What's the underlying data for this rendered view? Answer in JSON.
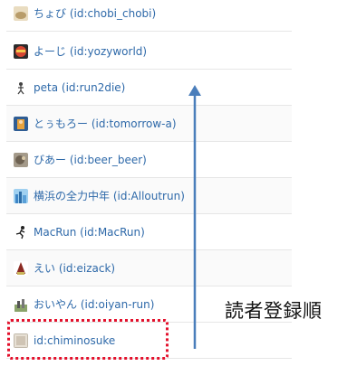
{
  "readers": [
    {
      "name": "ちょび",
      "id_label": "(id:chobi_chobi)",
      "icon": "chobi-avatar-icon",
      "color": "#d8c29a"
    },
    {
      "name": "よーじ",
      "id_label": "(id:yozyworld)",
      "icon": "yozy-avatar-icon",
      "color": "#c0392b"
    },
    {
      "name": "peta",
      "id_label": "(id:run2die)",
      "icon": "peta-avatar-icon",
      "color": "#e0e0e0"
    },
    {
      "name": "とぅもろー",
      "id_label": "(id:tomorrow-a)",
      "icon": "tomorrow-avatar-icon",
      "color": "#3b6ea8"
    },
    {
      "name": "びあー",
      "id_label": "(id:beer_beer)",
      "icon": "beer-avatar-icon",
      "color": "#8a8070"
    },
    {
      "name": "横浜の全力中年",
      "id_label": "(id:Alloutrun)",
      "icon": "alloutrun-avatar-icon",
      "color": "#5aa0d8"
    },
    {
      "name": "MacRun",
      "id_label": "(id:MacRun)",
      "icon": "macrun-avatar-icon",
      "color": "#333333"
    },
    {
      "name": "えい",
      "id_label": "(id:eizack)",
      "icon": "eizack-avatar-icon",
      "color": "#b03a2e"
    },
    {
      "name": "おいやん",
      "id_label": "(id:oiyan-run)",
      "icon": "oiyan-avatar-icon",
      "color": "#6c8a4a"
    },
    {
      "name": "",
      "id_label": "id:chiminosuke",
      "icon": "chiminosuke-avatar-icon",
      "color": "#cfc4b4"
    }
  ],
  "annotation": {
    "order_label": "読者登録順",
    "arrow_color": "#4a7ebb",
    "highlight_color": "#e3112c"
  }
}
